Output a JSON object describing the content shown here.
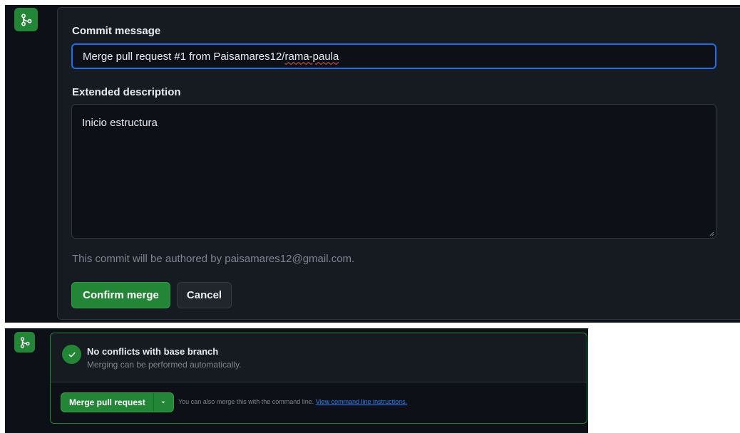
{
  "commit_form": {
    "commit_message_label": "Commit message",
    "commit_message_value_prefix": "Merge pull request #1 from Paisamares12/",
    "commit_message_value_flagged": "rama-paula",
    "extended_description_label": "Extended description",
    "extended_description_value": "Inicio estructura",
    "author_note": "This commit will be authored by paisamares12@gmail.com.",
    "confirm_label": "Confirm merge",
    "cancel_label": "Cancel"
  },
  "merge_status": {
    "title": "No conflicts with base branch",
    "subtitle": "Merging can be performed automatically.",
    "merge_button_label": "Merge pull request",
    "cli_text": "You can also merge this with the command line.",
    "cli_link": "View command line instructions."
  },
  "icons": {
    "merge": "git-merge-icon",
    "check": "check-icon",
    "caret": "caret-down-icon",
    "resize": "resize-grip-icon"
  },
  "colors": {
    "background": "#0d1117",
    "panel": "#161b22",
    "border": "#30363d",
    "accent_green": "#238636",
    "focus_blue": "#1f6feb",
    "link_blue": "#2f81f7",
    "text_primary": "#e6edf3",
    "text_muted": "#7d8590",
    "spell_error": "#f85149"
  }
}
